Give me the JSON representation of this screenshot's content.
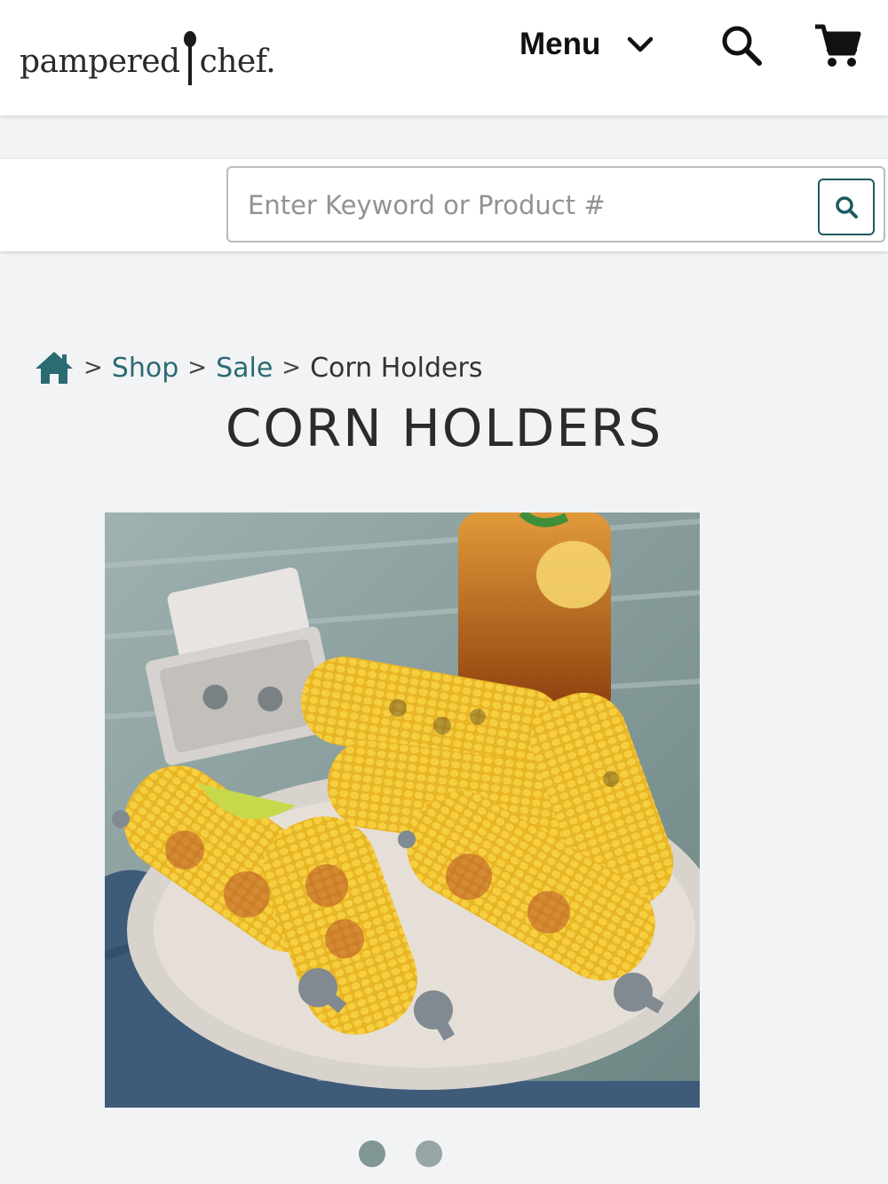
{
  "header": {
    "logo_left": "pampered",
    "logo_right": "chef.",
    "menu_label": "Menu",
    "icons": {
      "menu_chevron": "chevron-down-icon",
      "search": "search-icon",
      "cart": "cart-icon"
    }
  },
  "search": {
    "placeholder": "Enter Keyword or Product #",
    "value": "",
    "submit_icon": "search-icon"
  },
  "breadcrumb": {
    "home_icon": "home-icon",
    "items": [
      "Shop",
      "Sale",
      "Corn Holders"
    ],
    "separator": ">"
  },
  "product": {
    "title": "CORN HOLDERS",
    "carousel_slide_count": 2,
    "carousel_active_index": 0
  },
  "colors": {
    "accent": "#2b6b73",
    "background": "#f2f3f5",
    "dot": "#96a6a4"
  }
}
